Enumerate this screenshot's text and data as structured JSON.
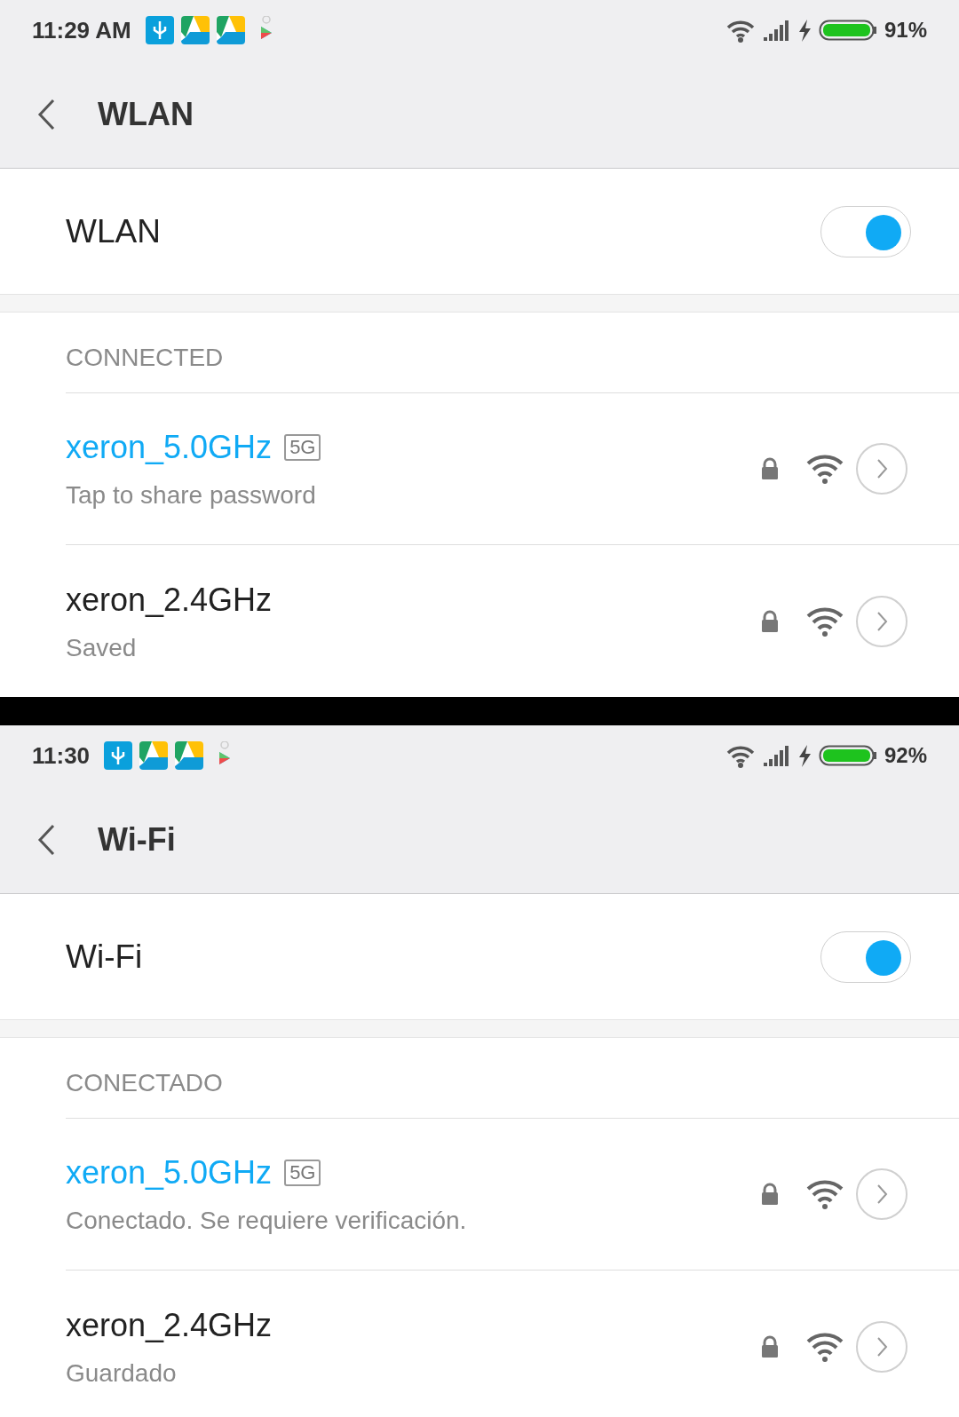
{
  "screens": [
    {
      "status_bar": {
        "time": "11:29 AM",
        "battery": "91%"
      },
      "header": {
        "title": "WLAN"
      },
      "toggle": {
        "label": "WLAN",
        "on": true
      },
      "section": "CONNECTED",
      "networks": [
        {
          "name": "xeron_5.0GHz",
          "badge": "5G",
          "subtitle": "Tap to share password",
          "connected": true
        },
        {
          "name": "xeron_2.4GHz",
          "subtitle": "Saved",
          "connected": false
        }
      ]
    },
    {
      "status_bar": {
        "time": "11:30",
        "battery": "92%"
      },
      "header": {
        "title": "Wi-Fi"
      },
      "toggle": {
        "label": "Wi-Fi",
        "on": true
      },
      "section": "CONECTADO",
      "networks": [
        {
          "name": "xeron_5.0GHz",
          "badge": "5G",
          "subtitle": "Conectado. Se requiere verificación.",
          "connected": true
        },
        {
          "name": "xeron_2.4GHz",
          "subtitle": "Guardado",
          "connected": false
        }
      ]
    }
  ]
}
